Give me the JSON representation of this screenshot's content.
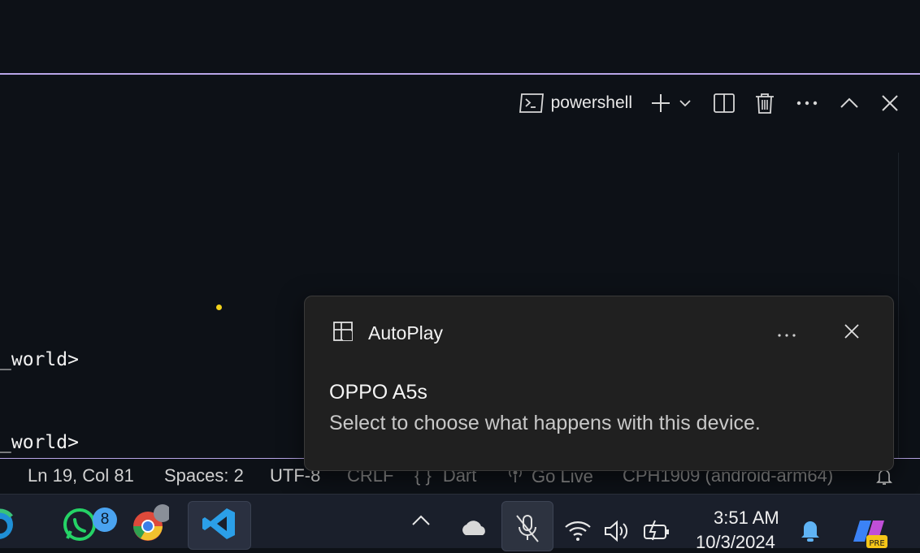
{
  "terminal": {
    "toolbar": {
      "shell_icon": "terminal-icon",
      "shell_label": "powershell"
    },
    "lines": [
      "_world>",
      "_world>"
    ]
  },
  "statusbar": {
    "position": "Ln 19, Col 81",
    "spaces": "Spaces: 2",
    "encoding": "UTF-8",
    "eol": "CRLF",
    "language": "Dart",
    "language_icon": "braces-icon",
    "golive": "Go Live",
    "golive_icon": "broadcast-icon",
    "device": "CPH1909 (android-arm64)",
    "bell_icon": "bell-icon"
  },
  "toast": {
    "app_name": "AutoPlay",
    "title": "OPPO A5s",
    "body": "Select to choose what happens with this device."
  },
  "taskbar": {
    "whatsapp_badge": "8",
    "time": "3:51 AM",
    "date": "10/3/2024"
  },
  "colors": {
    "panel_border": "#b9a6e8",
    "background": "#0d1117",
    "toast_bg": "#202020",
    "taskbar_bg": "#1a1f2b",
    "cursor": "#f2d21b"
  }
}
